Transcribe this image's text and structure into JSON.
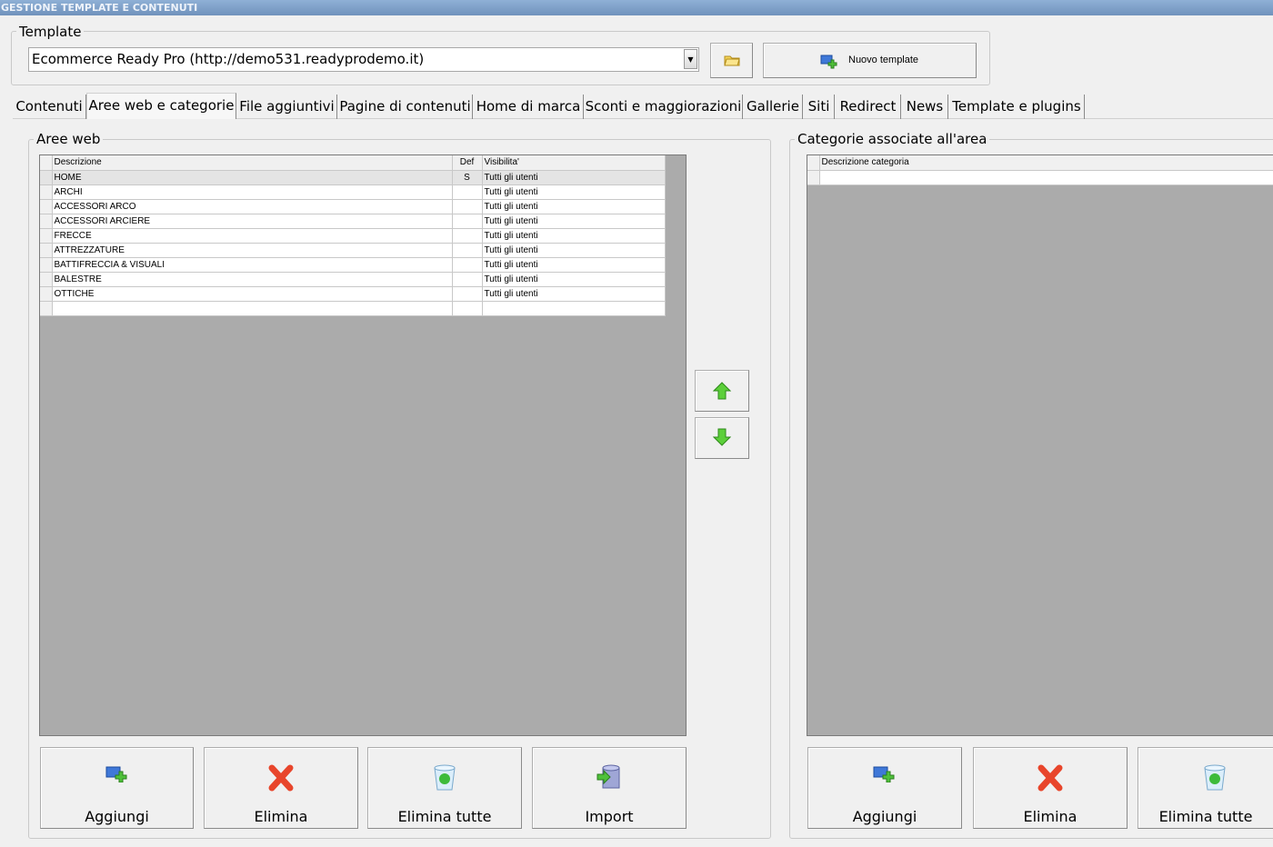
{
  "window_title": "GESTIONE TEMPLATE E CONTENUTI",
  "template": {
    "label": "Template",
    "selected": "Ecommerce Ready Pro (http://demo531.readyprodemo.it)",
    "new_button": "Nuovo template"
  },
  "tabs": [
    "Contenuti",
    "Aree web e categorie",
    "File aggiuntivi",
    "Pagine di contenuti",
    "Home di marca",
    "Sconti e maggiorazioni",
    "Gallerie",
    "Siti",
    "Redirect",
    "News",
    "Template e plugins"
  ],
  "aree_web": {
    "label": "Aree web",
    "columns": [
      "Descrizione",
      "Def",
      "Visibilita'"
    ],
    "rows": [
      [
        "HOME",
        "S",
        "Tutti gli utenti"
      ],
      [
        "ARCHI",
        "",
        "Tutti gli utenti"
      ],
      [
        "ACCESSORI ARCO",
        "",
        "Tutti gli utenti"
      ],
      [
        "ACCESSORI ARCIERE",
        "",
        "Tutti gli utenti"
      ],
      [
        "FRECCE",
        "",
        "Tutti gli utenti"
      ],
      [
        "ATTREZZATURE",
        "",
        "Tutti gli utenti"
      ],
      [
        "BATTIFRECCIA & VISUALI",
        "",
        "Tutti gli utenti"
      ],
      [
        "BALESTRE",
        "",
        "Tutti gli utenti"
      ],
      [
        "OTTICHE",
        "",
        "Tutti gli utenti"
      ]
    ],
    "buttons": [
      "Aggiungi",
      "Elimina",
      "Elimina tutte",
      "Import"
    ]
  },
  "categorie": {
    "label": "Categorie associate all'area",
    "columns": [
      "Descrizione categoria"
    ],
    "buttons": [
      "Aggiungi",
      "Elimina",
      "Elimina tutte"
    ]
  }
}
